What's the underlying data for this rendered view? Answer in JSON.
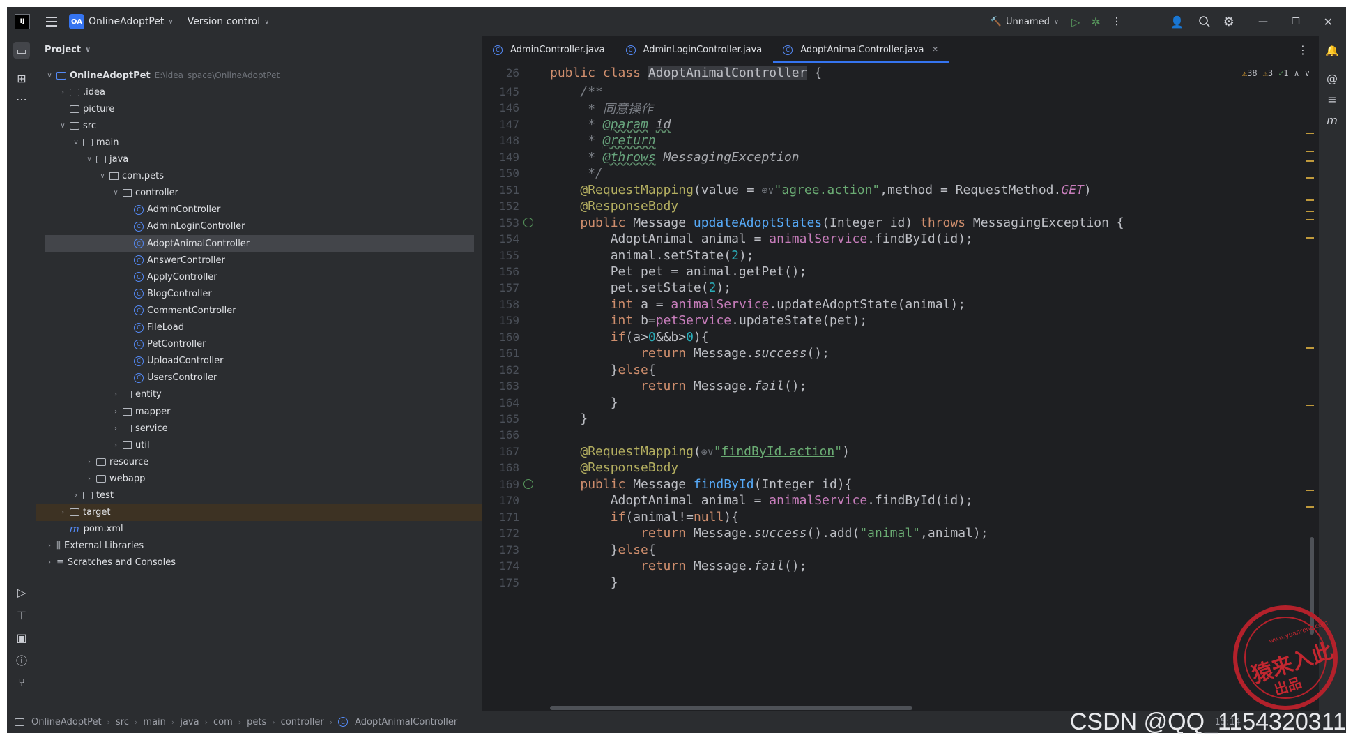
{
  "topbar": {
    "project_badge": "OA",
    "project_name": "OnlineAdoptPet",
    "vcs": "Version control",
    "run_config": "Unnamed"
  },
  "panel": {
    "title": "Project",
    "tree": [
      {
        "label": "OnlineAdoptPet",
        "extra": "E:\\idea_space\\OnlineAdoptPet",
        "depth": 0,
        "arrow": "down",
        "type": "folder",
        "bold": true
      },
      {
        "label": ".idea",
        "depth": 1,
        "arrow": "right",
        "type": "folder"
      },
      {
        "label": "picture",
        "depth": 1,
        "arrow": "",
        "type": "folder"
      },
      {
        "label": "src",
        "depth": 1,
        "arrow": "down",
        "type": "folder"
      },
      {
        "label": "main",
        "depth": 2,
        "arrow": "down",
        "type": "folder"
      },
      {
        "label": "java",
        "depth": 3,
        "arrow": "down",
        "type": "folder"
      },
      {
        "label": "com.pets",
        "depth": 4,
        "arrow": "down",
        "type": "pkg"
      },
      {
        "label": "controller",
        "depth": 5,
        "arrow": "down",
        "type": "pkg"
      },
      {
        "label": "AdminController",
        "depth": 6,
        "arrow": "",
        "type": "class"
      },
      {
        "label": "AdminLoginController",
        "depth": 6,
        "arrow": "",
        "type": "class"
      },
      {
        "label": "AdoptAnimalController",
        "depth": 6,
        "arrow": "",
        "type": "class",
        "selected": true
      },
      {
        "label": "AnswerController",
        "depth": 6,
        "arrow": "",
        "type": "class"
      },
      {
        "label": "ApplyController",
        "depth": 6,
        "arrow": "",
        "type": "class"
      },
      {
        "label": "BlogController",
        "depth": 6,
        "arrow": "",
        "type": "class"
      },
      {
        "label": "CommentController",
        "depth": 6,
        "arrow": "",
        "type": "class"
      },
      {
        "label": "FileLoad",
        "depth": 6,
        "arrow": "",
        "type": "class"
      },
      {
        "label": "PetController",
        "depth": 6,
        "arrow": "",
        "type": "class"
      },
      {
        "label": "UploadController",
        "depth": 6,
        "arrow": "",
        "type": "class"
      },
      {
        "label": "UsersController",
        "depth": 6,
        "arrow": "",
        "type": "class"
      },
      {
        "label": "entity",
        "depth": 5,
        "arrow": "right",
        "type": "pkg"
      },
      {
        "label": "mapper",
        "depth": 5,
        "arrow": "right",
        "type": "pkg"
      },
      {
        "label": "service",
        "depth": 5,
        "arrow": "right",
        "type": "pkg"
      },
      {
        "label": "util",
        "depth": 5,
        "arrow": "right",
        "type": "pkg"
      },
      {
        "label": "resource",
        "depth": 3,
        "arrow": "right",
        "type": "folder"
      },
      {
        "label": "webapp",
        "depth": 3,
        "arrow": "right",
        "type": "folder"
      },
      {
        "label": "test",
        "depth": 2,
        "arrow": "right",
        "type": "folder"
      },
      {
        "label": "target",
        "depth": 1,
        "arrow": "right",
        "type": "folder",
        "target": true
      },
      {
        "label": "pom.xml",
        "depth": 1,
        "arrow": "",
        "type": "maven"
      },
      {
        "label": "External Libraries",
        "depth": 0,
        "arrow": "right",
        "type": "lib"
      },
      {
        "label": "Scratches and Consoles",
        "depth": 0,
        "arrow": "right",
        "type": "scratch"
      }
    ]
  },
  "editor": {
    "tabs": [
      {
        "label": "AdminController.java",
        "active": false
      },
      {
        "label": "AdminLoginController.java",
        "active": false
      },
      {
        "label": "AdoptAnimalController.java",
        "active": true
      }
    ],
    "inspections": {
      "warnings": "38",
      "weak": "3",
      "ok": "1"
    },
    "sticky": {
      "num": "26",
      "html": "<span class='kw'>public class </span><span class='hl'>AdoptAnimalController</span> {"
    },
    "lines": [
      {
        "num": "145",
        "html": "    <span class='cm'>/**</span>"
      },
      {
        "num": "146",
        "html": "     <span class='cm'>* 同意操作</span>"
      },
      {
        "num": "147",
        "html": "     <span class='cm'>* </span><span class='cmtag'>@param</span><span class='cm'> </span><span class='cmtag' style='color:#a7a9ae'>id</span>"
      },
      {
        "num": "148",
        "html": "     <span class='cm'>* </span><span class='cmtag'>@return</span>"
      },
      {
        "num": "149",
        "html": "     <span class='cm'>* </span><span class='cmtag'>@throws</span><span class='cm' style='color:#a7a9ae'> MessagingException</span>"
      },
      {
        "num": "150",
        "html": "     <span class='cm'>*/</span>"
      },
      {
        "num": "151",
        "html": "    <span class='ann'>@RequestMapping</span>(value = <span class='inlay'>⊕∨</span><span class='str'>\"</span><span class='strl'>agree.action</span><span class='str'>\"</span>,method = RequestMethod.<span class='fld it'>GET</span>)"
      },
      {
        "num": "152",
        "html": "    <span class='ann'>@ResponseBody</span>"
      },
      {
        "num": "153",
        "html": "    <span class='kw'>public </span>Message <span class='fn'>updateAdoptStates</span>(Integer id) <span class='kw'>throws </span>MessagingException {",
        "gutter": true
      },
      {
        "num": "154",
        "html": "        AdoptAnimal animal = <span class='fld'>animalService</span>.findById(id);"
      },
      {
        "num": "155",
        "html": "        animal.setState(<span class='num'>2</span>);"
      },
      {
        "num": "156",
        "html": "        Pet pet = animal.getPet();"
      },
      {
        "num": "157",
        "html": "        pet.setState(<span class='num'>2</span>);"
      },
      {
        "num": "158",
        "html": "        <span class='kw'>int </span>a = <span class='fld'>animalService</span>.updateAdoptState(animal);"
      },
      {
        "num": "159",
        "html": "        <span class='kw'>int </span>b=<span class='fld'>petService</span>.updateState(pet);"
      },
      {
        "num": "160",
        "html": "        <span class='kw'>if</span>(a><span class='num'>0</span>&&b><span class='num'>0</span>){"
      },
      {
        "num": "161",
        "html": "            <span class='kw'>return </span>Message.<span class='it'>success</span>();"
      },
      {
        "num": "162",
        "html": "        }<span class='kw'>else</span>{"
      },
      {
        "num": "163",
        "html": "            <span class='kw'>return </span>Message.<span class='it'>fail</span>();"
      },
      {
        "num": "164",
        "html": "        }"
      },
      {
        "num": "165",
        "html": "    }"
      },
      {
        "num": "166",
        "html": ""
      },
      {
        "num": "167",
        "html": "    <span class='ann'>@RequestMapping</span>(<span class='inlay'>⊕∨</span><span class='str'>\"</span><span class='strl'>findById.action</span><span class='str'>\"</span>)"
      },
      {
        "num": "168",
        "html": "    <span class='ann'>@ResponseBody</span>"
      },
      {
        "num": "169",
        "html": "    <span class='kw'>public </span>Message <span class='fn'>findById</span>(Integer id){",
        "gutter": true
      },
      {
        "num": "170",
        "html": "        AdoptAnimal animal = <span class='fld'>animalService</span>.findById(id);"
      },
      {
        "num": "171",
        "html": "        <span class='kw'>if</span>(animal!=<span class='kw'>null</span>){"
      },
      {
        "num": "172",
        "html": "            <span class='kw'>return </span>Message.<span class='it'>success</span>().add(<span class='str'>\"animal\"</span>,animal);"
      },
      {
        "num": "173",
        "html": "        }<span class='kw'>else</span>{"
      },
      {
        "num": "174",
        "html": "            <span class='kw'>return </span>Message.<span class='it'>fail</span>();"
      },
      {
        "num": "175",
        "html": "        }"
      }
    ]
  },
  "status": {
    "breadcrumbs": [
      "OnlineAdoptPet",
      "src",
      "main",
      "java",
      "com",
      "pets",
      "controller",
      "AdoptAnimalController"
    ],
    "time": "15:14"
  },
  "watermark": "CSDN @QQ_1154320311",
  "stamp": {
    "top": "www.yuanrenc.com",
    "main": "猿来入此",
    "sub": "出品"
  }
}
